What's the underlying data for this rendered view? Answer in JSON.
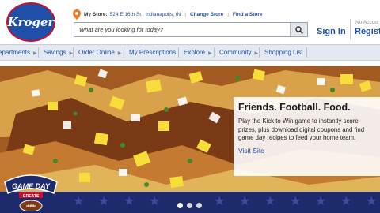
{
  "header": {
    "logo_text": "Kroger",
    "store_label": "My Store:",
    "store_address": "524 E 16th St , Indianapolis, IN",
    "change_store": "Change Store",
    "find_store": "Find a Store",
    "search_placeholder": "What are you looking for today?",
    "sign_in": "Sign In",
    "no_account": "No Accou",
    "register": "Registe"
  },
  "nav": {
    "items": [
      {
        "label": "epartments"
      },
      {
        "label": "Savings"
      },
      {
        "label": "Order Online"
      },
      {
        "label": "My Prescriptions"
      },
      {
        "label": "Explore"
      },
      {
        "label": "Community"
      },
      {
        "label": "Shopping List"
      }
    ]
  },
  "hero": {
    "title": "Friends. Football. Food.",
    "body": "Play the Kick to Win game to instantly score prizes, plus download digital coupons and find game day recipes to feed your home team.",
    "link": "Visit Site",
    "badge_line1": "GAME DAY",
    "badge_line2": "GREATS",
    "slides": 3,
    "active_slide": 1
  },
  "colors": {
    "brand_blue": "#1f4fa8",
    "brand_red": "#c8102e",
    "nav_bg": "#e4e9f0",
    "stars_band": "#1d2a6b"
  }
}
